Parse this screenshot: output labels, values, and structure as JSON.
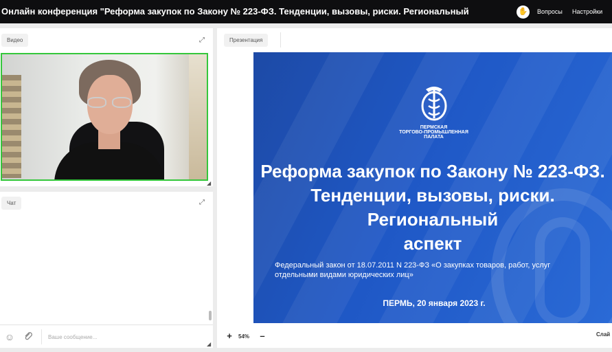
{
  "header": {
    "title": "Онлайн конференция \"Реформа закупок по Закону № 223-ФЗ. Тенденции, вызовы, риски. Региональный",
    "raise_hand_icon": "hand-icon",
    "questions_label": "Вопросы",
    "settings_label": "Настройки"
  },
  "video_panel": {
    "label": "Видео",
    "active_speaker_color": "#34c73b"
  },
  "chat_panel": {
    "label": "Чат",
    "input_placeholder": "Ваше сообщение...",
    "emoji_icon": "emoji-icon",
    "attach_icon": "paperclip-icon"
  },
  "presentation_panel": {
    "label": "Презентация",
    "zoom_level": "54%",
    "zoom_in": "+",
    "zoom_out": "–",
    "slides_label": "Слай"
  },
  "slide": {
    "org_name": "ПЕРМСКАЯ\nТОРГОВО-ПРОМЫШЛЕННАЯ\nПАЛАТА",
    "title": "Реформа закупок по Закону № 223-ФЗ.\nТенденции, вызовы, риски. Региональный\nаспект",
    "subtitle": "Федеральный закон от 18.07.2011 N 223-ФЗ «О закупках товаров, работ, услуг\nотдельными видами юридических лиц»",
    "date_line": "ПЕРМЬ, 20 января 2023 г.",
    "background_color": "#1f58c6"
  }
}
